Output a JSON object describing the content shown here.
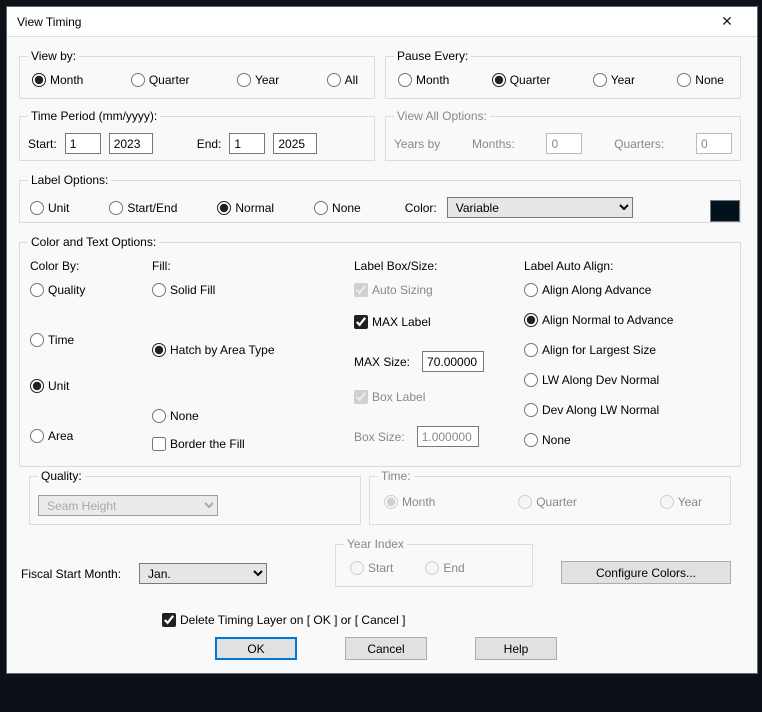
{
  "window": {
    "title": "View Timing"
  },
  "viewBy": {
    "legend": "View by:",
    "options": {
      "month": "Month",
      "quarter": "Quarter",
      "year": "Year",
      "all": "All"
    },
    "selected": "month"
  },
  "pauseEvery": {
    "legend": "Pause Every:",
    "options": {
      "month": "Month",
      "quarter": "Quarter",
      "year": "Year",
      "none": "None"
    },
    "selected": "quarter"
  },
  "timePeriod": {
    "legend": "Time Period (mm/yyyy):",
    "startLabel": "Start:",
    "startMonth": "1",
    "startYear": "2023",
    "endLabel": "End:",
    "endMonth": "1",
    "endYear": "2025"
  },
  "viewAll": {
    "legend": "View All Options:",
    "yearsByLabel": "Years by",
    "monthsLabel": "Months:",
    "monthsValue": "0",
    "quartersLabel": "Quarters:",
    "quartersValue": "0"
  },
  "labelOptions": {
    "legend": "Label Options:",
    "options": {
      "unit": "Unit",
      "startEnd": "Start/End",
      "normal": "Normal",
      "none": "None"
    },
    "selected": "normal",
    "colorLabel": "Color:",
    "colorSelect": "Variable",
    "swatch": "#02121d"
  },
  "colorText": {
    "legend": "Color and Text Options:",
    "colorBy": {
      "label": "Color By:",
      "options": {
        "quality": "Quality",
        "time": "Time",
        "unit": "Unit",
        "area": "Area"
      },
      "selected": "unit"
    },
    "fill": {
      "label": "Fill:",
      "options": {
        "solid": "Solid Fill",
        "hatch": "Hatch by Area Type",
        "none": "None"
      },
      "selected": "hatch",
      "borderFill": "Border the Fill",
      "borderFillChecked": false
    },
    "labelBox": {
      "label": "Label Box/Size:",
      "autoSizing": "Auto Sizing",
      "autoSizingChecked": true,
      "maxLabel": "MAX Label",
      "maxLabelChecked": true,
      "maxSizeLabel": "MAX Size:",
      "maxSize": "70.00000",
      "boxLabel": "Box Label",
      "boxLabelChecked": true,
      "boxSizeLabel": "Box Size:",
      "boxSize": "1.000000"
    },
    "autoAlign": {
      "label": "Label Auto Align:",
      "options": {
        "along": "Align Along Advance",
        "normal": "Align Normal to Advance",
        "largest": "Align for Largest Size",
        "lwDev": "LW Along Dev Normal",
        "devLw": "Dev Along LW Normal",
        "none": "None"
      },
      "selected": "normal"
    }
  },
  "quality": {
    "legend": "Quality:",
    "select": "Seam Height"
  },
  "time": {
    "legend": "Time:",
    "options": {
      "month": "Month",
      "quarter": "Quarter",
      "year": "Year"
    },
    "selected": "month"
  },
  "fiscal": {
    "label": "Fiscal Start Month:",
    "select": "Jan."
  },
  "yearIndex": {
    "legend": "Year Index",
    "options": {
      "start": "Start",
      "end": "End"
    }
  },
  "configureColors": "Configure Colors...",
  "deleteTiming": {
    "label": "Delete Timing Layer on [  OK  ] or [ Cancel ]",
    "checked": true
  },
  "buttons": {
    "ok": "OK",
    "cancel": "Cancel",
    "help": "Help"
  }
}
